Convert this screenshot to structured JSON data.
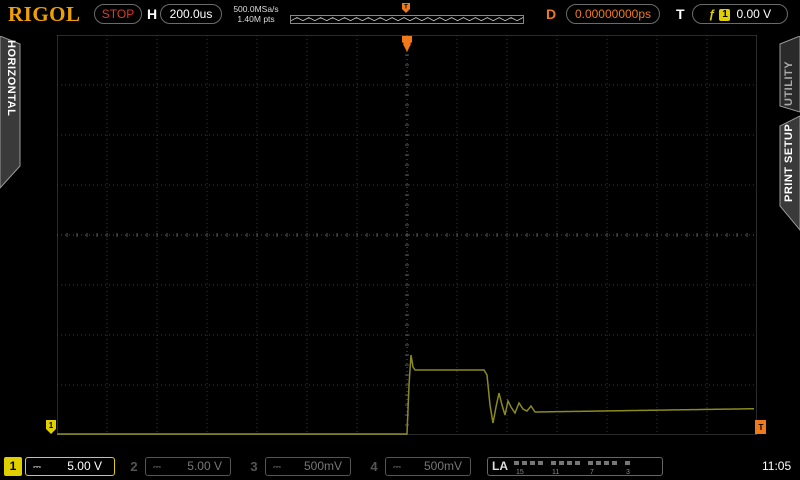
{
  "brand": "RIGOL",
  "run_status": "STOP",
  "horizontal": {
    "label": "H",
    "timebase": "200.0us",
    "sample_rate": "500.0MSa/s",
    "memory_depth": "1.40M pts"
  },
  "delay": {
    "label": "D",
    "value": "0.00000000ps"
  },
  "trigger": {
    "label": "T",
    "source": "1",
    "level": "0.00 V",
    "slope_icon": "rising-edge-icon"
  },
  "side_tabs": {
    "left": "HORIZONTAL",
    "right_top": "UTILITY",
    "right_bottom": "PRINT SETUP"
  },
  "channels": [
    {
      "number": "1",
      "coupling": "⎓",
      "scale": "5.00 V",
      "active": true,
      "color": "#e0d000"
    },
    {
      "number": "2",
      "coupling": "⎓",
      "scale": "5.00 V",
      "active": false,
      "color": "#555555"
    },
    {
      "number": "3",
      "coupling": "⎓",
      "scale": "500mV",
      "active": false,
      "color": "#555555"
    },
    {
      "number": "4",
      "coupling": "⎓",
      "scale": "500mV",
      "active": false,
      "color": "#555555"
    }
  ],
  "logic_analyzer": {
    "label": "LA",
    "channel_groups": [
      "15",
      "11",
      "7",
      "3"
    ]
  },
  "clock": "11:05",
  "colors": {
    "accent": "#f0a000",
    "stop": "#e03a2a",
    "ch1": "#e0d000",
    "trace": "#8a8a1e",
    "delay": "#f07a1a"
  }
}
